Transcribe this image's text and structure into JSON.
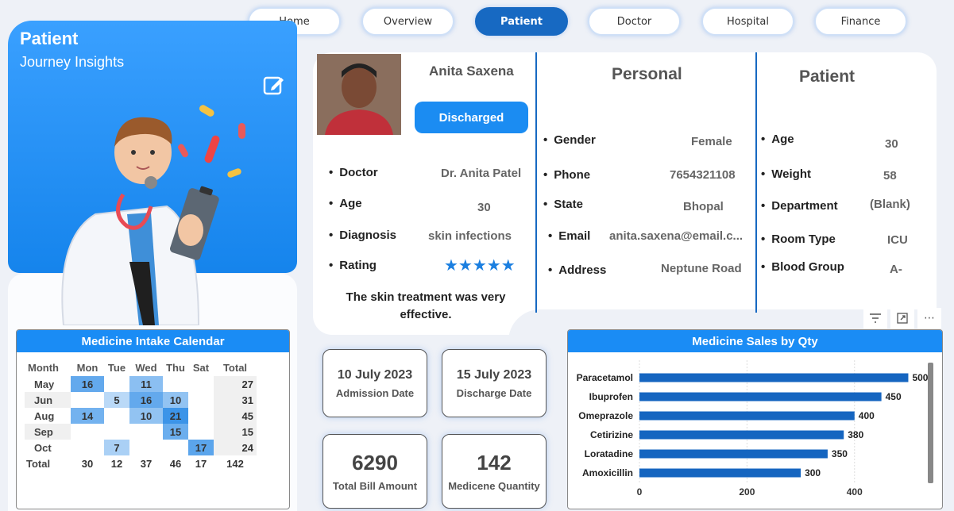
{
  "nav": [
    "Home",
    "Overview",
    "Patient",
    "Doctor",
    "Hospital",
    "Finance"
  ],
  "nav_active": "Patient",
  "hero": {
    "title": "Patient",
    "subtitle": "Journey Insights"
  },
  "patient": {
    "name": "Anita Saxena",
    "status": "Discharged",
    "doctor_label": "Doctor",
    "doctor": "Dr. Anita Patel",
    "age_label": "Age",
    "age": "30",
    "diagnosis_label": "Diagnosis",
    "diagnosis": "skin infections",
    "rating_label": "Rating",
    "rating": 5,
    "rating_text": "★★★★★",
    "review": "The skin treatment was very effective."
  },
  "personal": {
    "heading": "Personal",
    "gender_label": "Gender",
    "gender": "Female",
    "phone_label": "Phone",
    "phone": "7654321108",
    "state_label": "State",
    "state": "Bhopal",
    "email_label": "Email",
    "email": "anita.saxena@email.c...",
    "address_label": "Address",
    "address": "Neptune Road"
  },
  "patient_section": {
    "heading": "Patient",
    "age_label": "Age",
    "age": "30",
    "weight_label": "Weight",
    "weight": "58",
    "department_label": "Department",
    "department": "(Blank)",
    "room_label": "Room Type",
    "room": "ICU",
    "blood_label": "Blood Group",
    "blood": "A-"
  },
  "toolbar_icons": [
    "filter-icon",
    "expand-icon",
    "more-options-icon"
  ],
  "calendar": {
    "title": "Medicine Intake Calendar",
    "headers": [
      "Month",
      "Mon",
      "Tue",
      "Wed",
      "Thu",
      "Sat",
      "Total"
    ],
    "rows": [
      {
        "month": "May",
        "cells": [
          "16",
          "",
          "11",
          "",
          "",
          "27"
        ]
      },
      {
        "month": "Jun",
        "cells": [
          "",
          "5",
          "16",
          "10",
          "",
          "31"
        ]
      },
      {
        "month": "Aug",
        "cells": [
          "14",
          "",
          "10",
          "21",
          "",
          "45"
        ]
      },
      {
        "month": "Sep",
        "cells": [
          "",
          "",
          "",
          "15",
          "",
          "15"
        ]
      },
      {
        "month": "Oct",
        "cells": [
          "",
          "7",
          "",
          "",
          "17",
          "24"
        ]
      }
    ],
    "total": {
      "month": "Total",
      "cells": [
        "30",
        "12",
        "37",
        "46",
        "17",
        "142"
      ]
    }
  },
  "kpis": {
    "admission_date": "10 July 2023",
    "admission_label": "Admission Date",
    "discharge_date": "15 July 2023",
    "discharge_label": "Discharge Date",
    "bill": "6290",
    "bill_label": "Total Bill Amount",
    "qty": "142",
    "qty_label": "Medicene Quantity"
  },
  "colors": {
    "accent": "#1769c2",
    "header_blue": "#1a8cf5",
    "bar": "#1565c0"
  },
  "chart_data": {
    "type": "bar",
    "orientation": "horizontal",
    "title": "Medicine Sales by Qty",
    "categories": [
      "Paracetamol",
      "Ibuprofen",
      "Omeprazole",
      "Cetirizine",
      "Loratadine",
      "Amoxicillin"
    ],
    "values": [
      500,
      450,
      400,
      380,
      350,
      300
    ],
    "xticks": [
      "0",
      "200",
      "400"
    ],
    "xlim": [
      0,
      520
    ],
    "grid": true
  }
}
